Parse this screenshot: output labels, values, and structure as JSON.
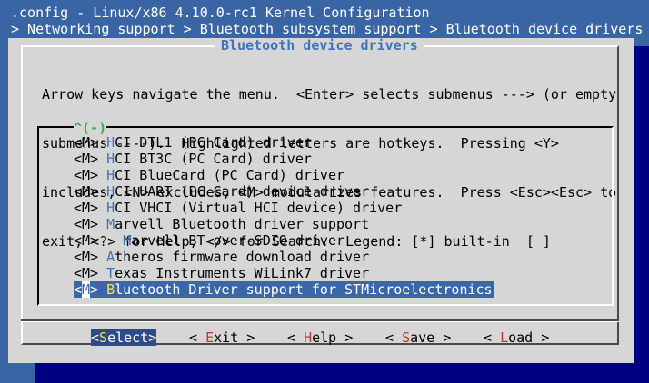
{
  "window": {
    "title": ".config - Linux/x86 4.10.0-rc1 Kernel Configuration",
    "breadcrumb": "> Networking support > Bluetooth subsystem support > Bluetooth device drivers"
  },
  "dialog": {
    "title": "Bluetooth device drivers",
    "help_lines": [
      "Arrow keys navigate the menu.  <Enter> selects submenus ---> (or empty",
      "submenus ----).  Highlighted letters are hotkeys.  Pressing <Y>",
      "includes, <N> excludes, <M> modularizes features.  Press <Esc><Esc> to",
      "exit, <?> for Help, </> for Search.  Legend: [*] built-in  [ ]"
    ],
    "scroll_indicator": "^(-)",
    "items": [
      {
        "mark": "<M>",
        "indent": " ",
        "hot": "H",
        "rest": "CI DTL1 (PC Card) driver"
      },
      {
        "mark": "<M>",
        "indent": " ",
        "hot": "H",
        "rest": "CI BT3C (PC Card) driver"
      },
      {
        "mark": "<M>",
        "indent": " ",
        "hot": "H",
        "rest": "CI BlueCard (PC Card) driver"
      },
      {
        "mark": "<M>",
        "indent": " ",
        "hot": "H",
        "rest": "CI UART (PC Card) device driver"
      },
      {
        "mark": "<M>",
        "indent": " ",
        "hot": "H",
        "rest": "CI VHCI (Virtual HCI device) driver"
      },
      {
        "mark": "<M>",
        "indent": " ",
        "hot": "M",
        "rest": "arvell Bluetooth driver support"
      },
      {
        "mark": "<M>",
        "indent": "   ",
        "hot": "M",
        "rest": "arvell BT-over-SDIO driver"
      },
      {
        "mark": "<M>",
        "indent": " ",
        "hot": "A",
        "rest": "theros firmware download driver"
      },
      {
        "mark": "<M>",
        "indent": " ",
        "hot": "T",
        "rest": "exas Instruments WiLink7 driver"
      },
      {
        "mark": "<M>",
        "indent": " ",
        "hot": "B",
        "rest": "luetooth Driver support for STMicroelectronics",
        "selected": true
      }
    ],
    "buttons": [
      {
        "pre": "<",
        "hot": "S",
        "rest": "elect>",
        "active": true
      },
      {
        "pre": "< ",
        "hot": "E",
        "rest": "xit >",
        "active": false
      },
      {
        "pre": "< ",
        "hot": "H",
        "rest": "elp >",
        "active": false
      },
      {
        "pre": "< ",
        "hot": "S",
        "rest": "ave >",
        "active": false
      },
      {
        "pre": "< ",
        "hot": "L",
        "rest": "oad >",
        "active": false
      }
    ]
  }
}
